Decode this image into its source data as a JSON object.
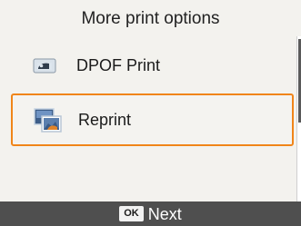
{
  "header": {
    "title": "More print options"
  },
  "menu": {
    "items": [
      {
        "label": "DPOF Print",
        "icon": "dpof-print-icon",
        "selected": false
      },
      {
        "label": "Reprint",
        "icon": "reprint-icon",
        "selected": true
      }
    ]
  },
  "footer": {
    "ok_label": "OK",
    "next_label": "Next"
  },
  "colors": {
    "selection_border": "#f08519",
    "footer_background": "#4f4f4f",
    "background": "#f3f2ee"
  }
}
